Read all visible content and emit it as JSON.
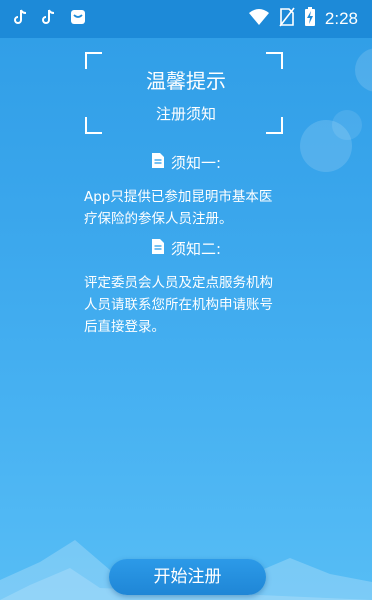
{
  "status_bar": {
    "time": "2:28",
    "left_icons": [
      "tiktok-icon",
      "tiktok-icon",
      "app-notification-icon"
    ],
    "right_icons": [
      "wifi-icon",
      "no-sim-icon",
      "battery-charging-icon"
    ]
  },
  "header": {
    "title": "温馨提示",
    "subtitle": "注册须知"
  },
  "notices": [
    {
      "heading": "须知一:",
      "lines": [
        "App只提供已参加昆明市基本医",
        "疗保险的参保人员注册。"
      ]
    },
    {
      "heading": "须知二:",
      "lines": [
        "评定委员会人员及定点服务机构",
        "人员请联系您所在机构申请账号",
        "后直接登录。"
      ]
    }
  ],
  "actions": {
    "start_register_label": "开始注册"
  },
  "colors": {
    "background_top": "#2f9de6",
    "background_bottom": "#57bdf5",
    "status_bar": "#1d8ad8",
    "button": "#1f86d6",
    "text": "#ffffff"
  }
}
